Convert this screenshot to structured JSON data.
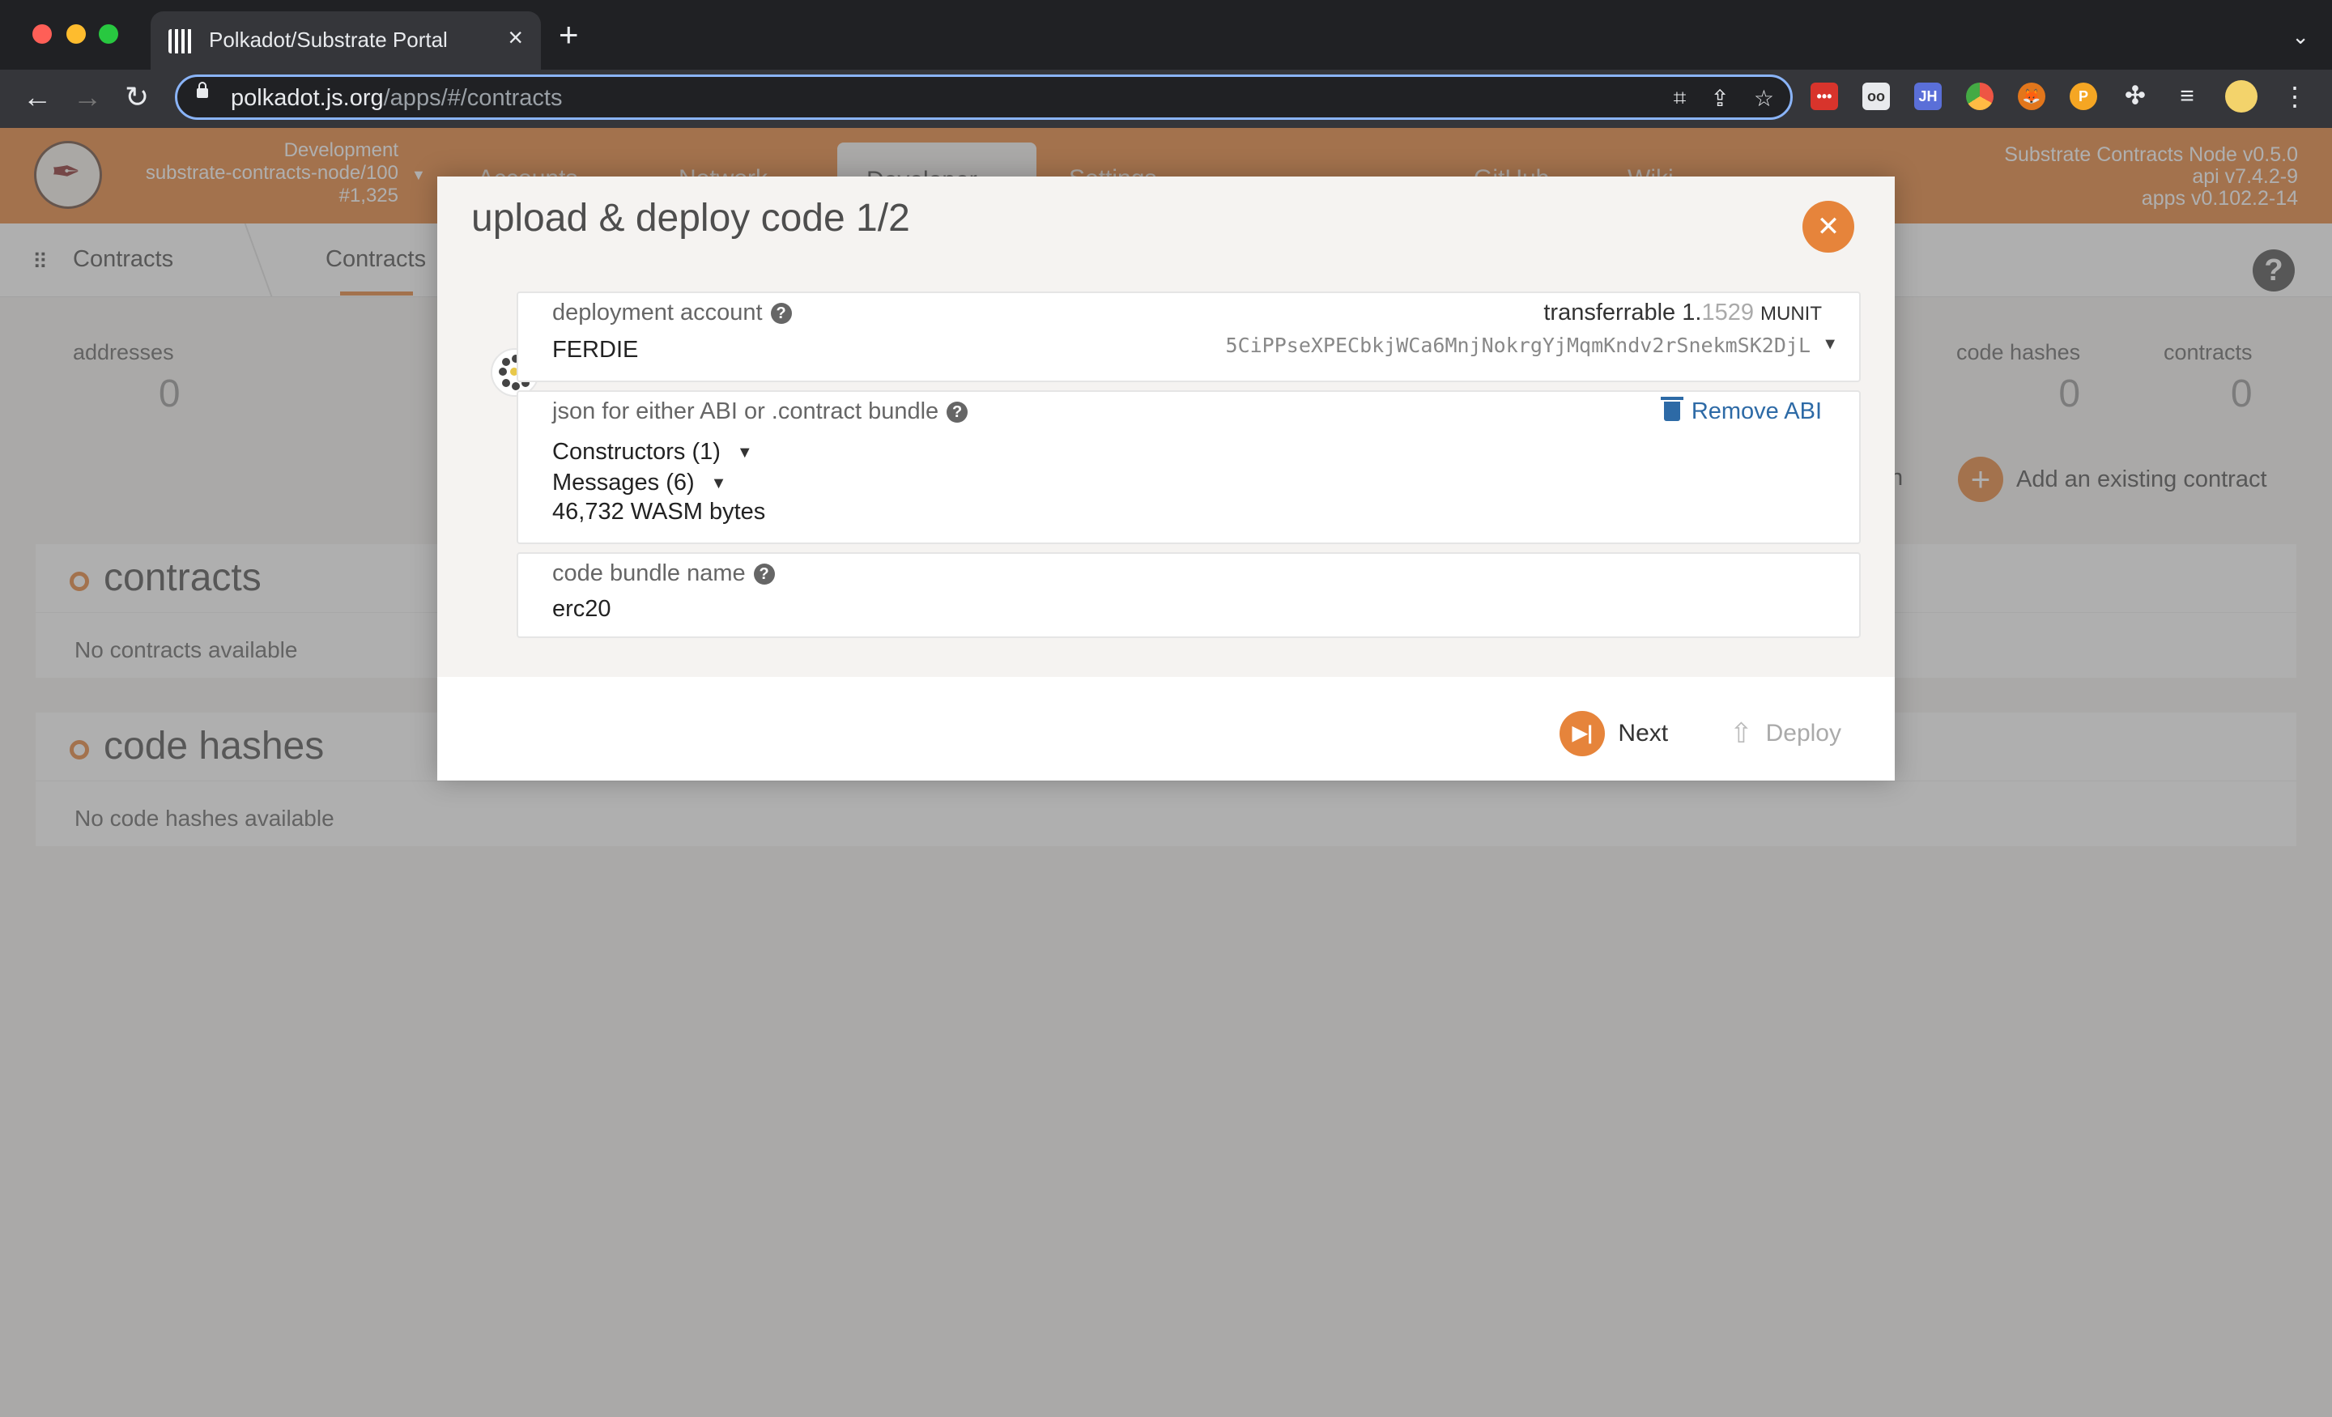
{
  "browser": {
    "tab_title": "Polkadot/Substrate Portal",
    "url_host": "polkadot.js.org",
    "url_path": "/apps/#/contracts"
  },
  "appbar": {
    "chain_type": "Development",
    "node": "substrate-contracts-node/100",
    "block": "#1,325",
    "menu": [
      "Accounts",
      "Network",
      "Developer",
      "Settings",
      "GitHub",
      "Wiki"
    ],
    "version": [
      "Substrate Contracts Node v0.5.0",
      "api v7.4.2-9",
      "apps v0.102.2-14"
    ]
  },
  "subnav": {
    "section": "Contracts",
    "tab": "Contracts"
  },
  "stats": {
    "addresses_label": "addresses",
    "addresses_value": "0",
    "code_hashes_label": "code hashes",
    "code_hashes_value": "0",
    "contracts_label": "contracts",
    "contracts_value": "0"
  },
  "actions": {
    "partial_label": "h",
    "add_existing": "Add an existing contract"
  },
  "sections": {
    "contracts_title": "contracts",
    "contracts_empty": "No contracts available",
    "codehashes_title": "code hashes",
    "codehashes_empty": "No code hashes available"
  },
  "modal": {
    "title": "upload & deploy code 1/2",
    "deployment_account_label": "deployment account",
    "account_name": "FERDIE",
    "transferrable_label": "transferrable",
    "transferrable_int": "1.",
    "transferrable_dec": "1529",
    "unit": "MUNIT",
    "address": "5CiPPseXPECbkjWCa6MnjNokrgYjMqmKndv2rSnekmSK2DjL",
    "json_label": "json for either ABI or .contract bundle",
    "remove_abi": "Remove ABI",
    "constructors": "Constructors (1)",
    "messages": "Messages (6)",
    "wasm_bytes": "46,732 WASM bytes",
    "bundle_name_label": "code bundle name",
    "bundle_name_value": "erc20",
    "next_button": "Next",
    "deploy_button": "Deploy"
  },
  "colors": {
    "accent": "#e6843b",
    "link": "#2d6aa6"
  }
}
